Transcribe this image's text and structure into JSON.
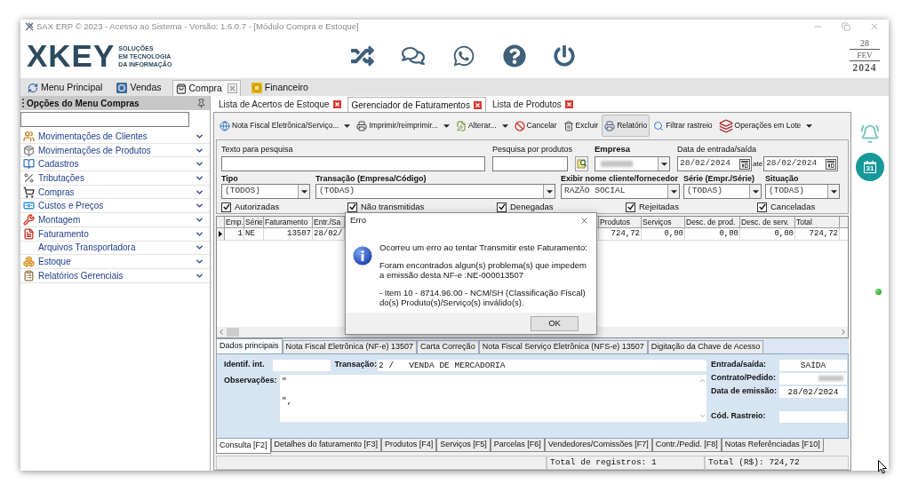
{
  "window": {
    "title": "SAX ERP © 2023 - Acesso ao Sistema - Versão: 1.6.0.7 - [Módulo Compra e Estoque]"
  },
  "logo": {
    "wordmark": "XKEY",
    "tagline": [
      "SOLUÇÕES",
      "EM TECNOLOGIA",
      "DA INFORMAÇÃO"
    ]
  },
  "date_display": {
    "day": "28",
    "month": "FEV",
    "year": "2024"
  },
  "module_tabs": [
    {
      "label": "Menu Principal",
      "kind": "home",
      "selected": false,
      "closable": false
    },
    {
      "label": "Vendas",
      "kind": "sales",
      "selected": false,
      "closable": false
    },
    {
      "label": "Compra",
      "kind": "purchase",
      "selected": true,
      "closable": true
    },
    {
      "label": "Financeiro",
      "kind": "finance",
      "selected": false,
      "closable": false
    }
  ],
  "sidebar": {
    "title": "Opções do Menu Compras",
    "items": [
      {
        "label": "Movimentações de Clientes",
        "kind": "clients"
      },
      {
        "label": "Movimentações de Produtos",
        "kind": "products"
      },
      {
        "label": "Cadastros",
        "kind": "registers"
      },
      {
        "label": "Tributações",
        "kind": "taxes"
      },
      {
        "label": "Compras",
        "kind": "purchases"
      },
      {
        "label": "Custos e Preços",
        "kind": "costs"
      },
      {
        "label": "Montagem",
        "kind": "assembly"
      },
      {
        "label": "Faturamento",
        "kind": "billing"
      },
      {
        "label": "Arquivos Transportadora",
        "kind": "plain"
      },
      {
        "label": "Estoque",
        "kind": "stock"
      },
      {
        "label": "Relatórios Gerenciais",
        "kind": "reports"
      }
    ]
  },
  "document_tabs": [
    {
      "label": "Lista de Acertos de Estoque",
      "selected": false
    },
    {
      "label": "Gerenciador de Faturamentos",
      "selected": true
    },
    {
      "label": "Lista de Produtos",
      "selected": false
    }
  ],
  "toolbar": [
    {
      "label": "Nota Fiscal Eletrônica/Serviço...",
      "kind": "nfe",
      "dropdown": true,
      "highlighted": false
    },
    {
      "label": "Imprimir/reimprimir...",
      "kind": "print",
      "dropdown": true,
      "highlighted": false
    },
    {
      "label": "Alterar...",
      "kind": "edit",
      "dropdown": true,
      "highlighted": false
    },
    {
      "label": "Cancelar",
      "kind": "cancel",
      "dropdown": false,
      "highlighted": false
    },
    {
      "label": "Excluir",
      "kind": "delete",
      "dropdown": false,
      "highlighted": false
    },
    {
      "label": "Relatório",
      "kind": "report",
      "dropdown": false,
      "highlighted": true
    },
    {
      "label": "Filtrar rastreio",
      "kind": "filter",
      "dropdown": false,
      "highlighted": false
    },
    {
      "label": "Operações em Lote",
      "kind": "batch",
      "dropdown": true,
      "highlighted": false
    }
  ],
  "filters": {
    "text_search": {
      "label": "Texto para pesquisa"
    },
    "product_search": {
      "label": "Pesquisa por produtos"
    },
    "company": {
      "label": "Empresa"
    },
    "date_range": {
      "label": "Data de entrada/saída",
      "from": "28/02/2024",
      "separator": "até",
      "to": "28/02/2024"
    },
    "selects": [
      {
        "label": "Tipo",
        "value": "(TODOS)"
      },
      {
        "label": "Transação (Empresa/Código)",
        "value": "(TODAS)"
      },
      {
        "label": "Exibir nome cliente/fornecedor",
        "value": "RAZÃO SOCIAL"
      },
      {
        "label": "Série (Empr./Série)",
        "value": "(TODAS)"
      },
      {
        "label": "Situação",
        "value": "(TODAS)"
      }
    ],
    "status_checks": [
      {
        "label": "Autorizadas",
        "checked": true
      },
      {
        "label": "Não transmitidas",
        "checked": true
      },
      {
        "label": "Denegadas",
        "checked": true
      },
      {
        "label": "Rejeitadas",
        "checked": true
      },
      {
        "label": "Canceladas",
        "checked": true
      }
    ]
  },
  "grid": {
    "columns": [
      "Emp.",
      "Série",
      "Faturamento",
      "Entr./Sa",
      "Produtos",
      "Serviços",
      "Desc. de prod.",
      "Desc. de serv.",
      "Total"
    ],
    "rows": [
      {
        "selected": true,
        "cells": [
          "1",
          "NE",
          "13507",
          "28/02/",
          "724,72",
          "0,00",
          "0,00",
          "0,00",
          "724,72"
        ]
      }
    ]
  },
  "dialog": {
    "title": "Erro",
    "message": [
      "Ocorreu um erro ao tentar Transmitir este Faturamento:",
      "Foram encontrados algun(s) problema(s) que impedem a emissão desta NF-e :NE-000013507",
      "- Item 10 - 8714.96.00 - NCM/SH (Classificação Fiscal) do(s) Produto(s)/Serviço(s) inválido(s)."
    ],
    "button": "OK"
  },
  "detail_tabs": [
    {
      "label": "Dados principais",
      "selected": true
    },
    {
      "label": "Nota Fiscal Eletrônica (NF-e) 13507",
      "selected": false
    },
    {
      "label": "Carta Correção",
      "selected": false
    },
    {
      "label": "Nota Fiscal Serviço Eletrônica (NFS-e) 13507",
      "selected": false
    },
    {
      "label": "Digitação da Chave de Acesso",
      "selected": false
    }
  ],
  "details": {
    "internal_id": {
      "label": "Identif. int."
    },
    "transaction": {
      "label": "Transação:",
      "value": "2 /   VENDA DE MERCADORIA"
    },
    "notes": {
      "label": "Observações:",
      "value": "\"\n\n\","
    },
    "entry_exit": {
      "label": "Entrada/saída:",
      "value": "SAÍDA"
    },
    "contract": {
      "label": "Contrato/Pedido:"
    },
    "issue_date": {
      "label": "Data de emissão:",
      "value": "28/02/2024"
    },
    "tracking_code": {
      "label": "Cód. Rastreio:"
    }
  },
  "bottom_tabs": [
    {
      "label": "Consulta [F2]",
      "selected": true
    },
    {
      "label": "Detalhes do faturamento [F3]",
      "selected": false
    },
    {
      "label": "Produtos [F4]",
      "selected": false
    },
    {
      "label": "Serviços [F5]",
      "selected": false
    },
    {
      "label": "Parcelas [F6]",
      "selected": false
    },
    {
      "label": "Vendedores/Comissões [F7]",
      "selected": false
    },
    {
      "label": "Contr./Pedid. [F8]",
      "selected": false
    },
    {
      "label": "Notas Referênciadas [F10]",
      "selected": false
    }
  ],
  "status_bar": {
    "records": "Total de registros: 1",
    "total": "Total (R$): 724,72"
  },
  "side_panel": {
    "calendar_day": "31"
  }
}
